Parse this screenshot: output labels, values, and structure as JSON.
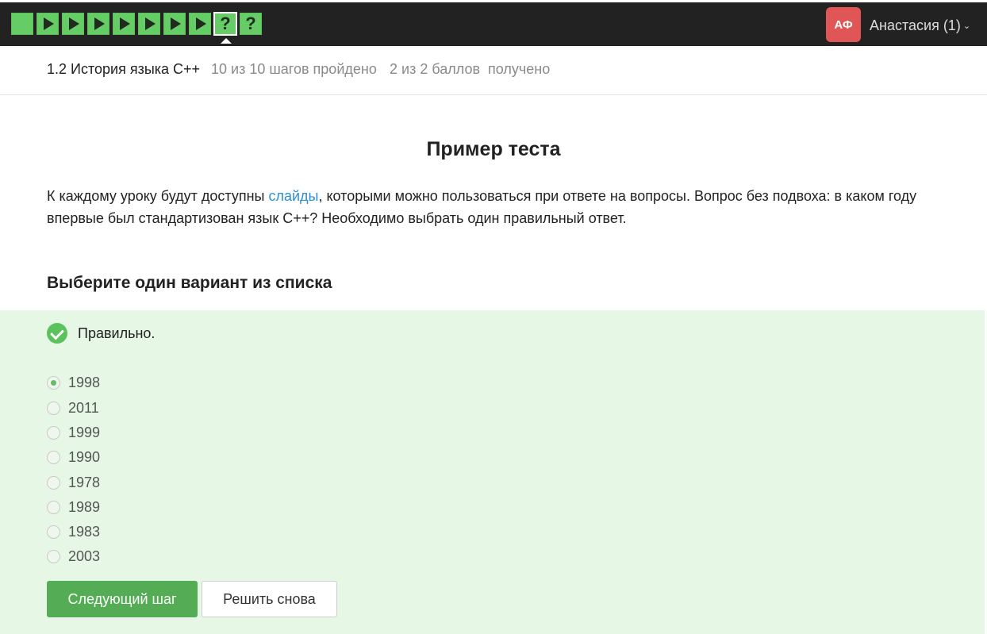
{
  "steps": [
    {
      "type": "text",
      "status": "passed"
    },
    {
      "type": "video",
      "status": "passed"
    },
    {
      "type": "video",
      "status": "passed"
    },
    {
      "type": "video",
      "status": "passed"
    },
    {
      "type": "video",
      "status": "passed"
    },
    {
      "type": "video",
      "status": "passed"
    },
    {
      "type": "video",
      "status": "passed"
    },
    {
      "type": "video",
      "status": "passed"
    },
    {
      "type": "quiz",
      "status": "passed",
      "current": true,
      "glyph": "?"
    },
    {
      "type": "quiz",
      "status": "passed",
      "glyph": "?"
    }
  ],
  "user": {
    "initials": "АФ",
    "name": "Анастасия (1)",
    "avatar_color": "#e05555"
  },
  "lesson": {
    "title": "1.2 История языка C++",
    "steps_progress": "10 из 10 шагов пройдено",
    "score_progress": "2 из 2 баллов  получено"
  },
  "step": {
    "title": "Пример теста",
    "text_before_link": "К каждому уроку будут доступны ",
    "link_text": "слайды",
    "text_after_link": ", которыми можно пользоваться при ответе на вопросы. Вопрос без подвоха: в каком году впервые был стандартизован язык C++? Необходимо выбрать один правильный ответ."
  },
  "quiz": {
    "prompt": "Выберите один вариант из списка",
    "feedback": "Правильно.",
    "options": [
      "1998",
      "2011",
      "1999",
      "1990",
      "1978",
      "1989",
      "1983",
      "2003"
    ],
    "selected": "1998",
    "next_button": "Следующий шаг",
    "retry_button": "Решить снова"
  },
  "colors": {
    "accent_green": "#66cc66",
    "panel_green": "#e6f7e6",
    "button_green": "#54ad54",
    "link_blue": "#2b8fd6",
    "topbar": "#222222"
  }
}
